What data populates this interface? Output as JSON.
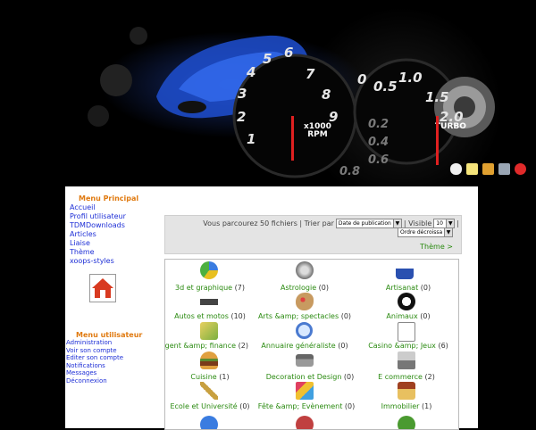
{
  "banner": {
    "gauge_left_numbers": [
      "1",
      "2",
      "3",
      "4",
      "5",
      "6",
      "7",
      "8",
      "9"
    ],
    "gauge_left_label": "x1000\nRPM",
    "gauge_right_numbers": [
      "0",
      "0.5",
      "1.0",
      "1.5",
      "2.0"
    ],
    "gauge_right_minor": [
      "0.2",
      "0.4",
      "0.6",
      "0.8"
    ],
    "gauge_right_label": "TURBO",
    "tool_icons": [
      "chat-icon",
      "notepad-icon",
      "calendar-icon",
      "tools-icon",
      "power-icon"
    ]
  },
  "sidebar": {
    "main_menu_title": "Menu Principal",
    "main_menu_items": [
      "Accueil",
      "Profil utilisateur",
      "TDMDownloads",
      "Articles",
      "Liaise",
      "Thème",
      "xoops-styles"
    ],
    "user_menu_title": "Menu utilisateur",
    "user_menu_items": [
      "Administration",
      "Voir son compte",
      "Editer son compte",
      "Notifications",
      "Messages",
      "Déconnexion"
    ]
  },
  "sort_bar": {
    "browse_text": "Vous parcourez 50 fichiers | Trier par",
    "sort_value": "Date de publication",
    "visible_label": "| Visible",
    "visible_value": "10",
    "trailing": "|",
    "order_value": "Ordre décroissant",
    "theme_link": "Thème >"
  },
  "categories": [
    {
      "name": "3d et graphique",
      "count": "(7)",
      "icon": "pie-chart-icon"
    },
    {
      "name": "Astrologie",
      "count": "(0)",
      "icon": "zodiac-icon"
    },
    {
      "name": "Artisanat",
      "count": "(0)",
      "icon": "craft-icon"
    },
    {
      "name": "Autos et motos",
      "count": "(10)",
      "icon": "car-icon"
    },
    {
      "name": "Arts &amp; spectacles",
      "count": "(0)",
      "icon": "palette-icon"
    },
    {
      "name": "Animaux",
      "count": "(0)",
      "icon": "panda-icon"
    },
    {
      "name": "Argent &amp; finance",
      "count": "(2)",
      "icon": "money-icon"
    },
    {
      "name": "Annuaire généraliste",
      "count": "(0)",
      "icon": "magnifier-icon"
    },
    {
      "name": "Casino &amp; Jeux",
      "count": "(6)",
      "icon": "cards-icon"
    },
    {
      "name": "Cuisine",
      "count": "(1)",
      "icon": "burger-icon"
    },
    {
      "name": "Decoration et Design",
      "count": "(0)",
      "icon": "sofa-icon"
    },
    {
      "name": "E commerce",
      "count": "(2)",
      "icon": "register-icon"
    },
    {
      "name": "Ecole et Université",
      "count": "(0)",
      "icon": "ruler-icon"
    },
    {
      "name": "Fête &amp; Evènement",
      "count": "(0)",
      "icon": "party-icon"
    },
    {
      "name": "Immobilier",
      "count": "(1)",
      "icon": "house-key-icon"
    }
  ],
  "colors": {
    "link_blue": "#1e2fd6",
    "menu_orange": "#e07a10",
    "category_green": "#2a8a10",
    "banner_blue": "#2850c8",
    "needle_red": "#e02020"
  }
}
